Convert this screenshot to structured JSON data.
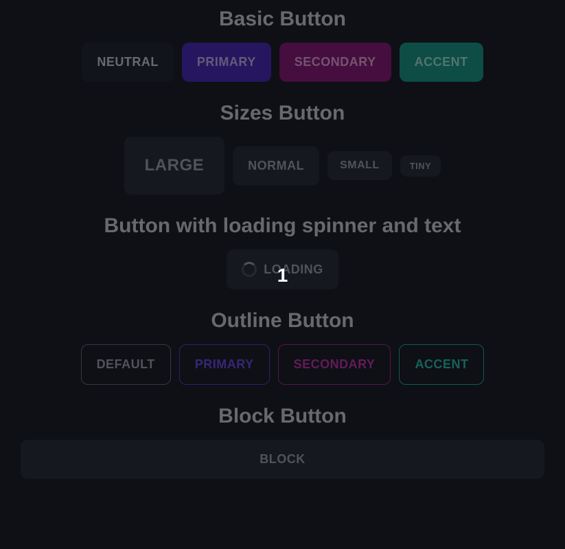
{
  "sections": {
    "basic": {
      "title": "Basic Button",
      "buttons": {
        "neutral": "NEUTRAL",
        "primary": "PRIMARY",
        "secondary": "SECONDARY",
        "accent": "ACCENT"
      }
    },
    "sizes": {
      "title": "Sizes Button",
      "buttons": {
        "large": "LARGE",
        "normal": "NORMAL",
        "small": "SMALL",
        "tiny": "TINY"
      }
    },
    "loading": {
      "title": "Button with loading spinner and text",
      "button": "LOADING",
      "counter": "1"
    },
    "outline": {
      "title": "Outline Button",
      "buttons": {
        "default": "DEFAULT",
        "primary": "PRIMARY",
        "secondary": "SECONDARY",
        "accent": "ACCENT"
      }
    },
    "block": {
      "title": "Block Button",
      "button": "BLOCK"
    }
  }
}
